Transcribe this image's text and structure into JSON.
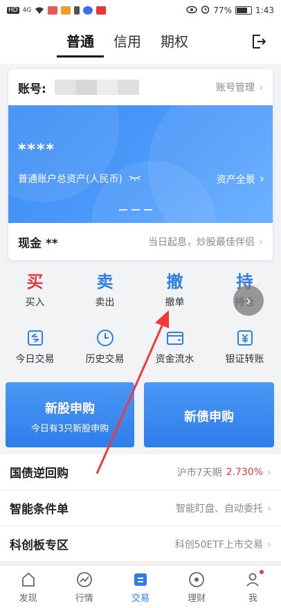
{
  "status_bar": {
    "network": "HD",
    "signal": "4G",
    "battery_percent": "77%",
    "time": "1:43"
  },
  "header": {
    "tabs": [
      {
        "label": "普通",
        "active": true
      },
      {
        "label": "信用",
        "active": false
      },
      {
        "label": "期权",
        "active": false
      }
    ],
    "exit_icon": "exit-icon"
  },
  "account": {
    "label": "账号:",
    "manage_label": "账号管理",
    "total_asset_value": "****",
    "total_asset_label": "普通账户总资产(人民币)",
    "asset_overview": "资产全景",
    "cash_label": "现金 **",
    "cash_tip": "当日起息，炒股最佳伴侣"
  },
  "trade_actions": [
    {
      "char": "买",
      "label": "买入"
    },
    {
      "char": "卖",
      "label": "卖出"
    },
    {
      "char": "撤",
      "label": "撤单"
    },
    {
      "char": "持",
      "label": "持仓"
    }
  ],
  "tools": [
    {
      "label": "今日交易",
      "icon": "today-trade-icon"
    },
    {
      "label": "历史交易",
      "icon": "clock-icon"
    },
    {
      "label": "资金流水",
      "icon": "wallet-icon"
    },
    {
      "label": "银证转账",
      "icon": "bank-transfer-icon"
    }
  ],
  "ipo": {
    "stock_title": "新股申购",
    "stock_sub": "今日有3只新股申购",
    "bond_title": "新债申购"
  },
  "list": [
    {
      "title": "国债逆回购",
      "right_text": "沪市7天期",
      "right_value": "2.730%"
    },
    {
      "title": "智能条件单",
      "right_text": "智能盯盘、自动委托",
      "right_value": ""
    },
    {
      "title": "科创板专区",
      "right_text": "科创50ETF上市交易",
      "right_value": ""
    }
  ],
  "bottom_nav": [
    {
      "label": "发现",
      "icon": "discover-icon",
      "active": false
    },
    {
      "label": "行情",
      "icon": "market-icon",
      "active": false
    },
    {
      "label": "交易",
      "icon": "trade-icon",
      "active": true
    },
    {
      "label": "理财",
      "icon": "finance-icon",
      "active": false
    },
    {
      "label": "我",
      "icon": "profile-icon",
      "active": false
    }
  ],
  "colors": {
    "accent_blue": "#2f7de9",
    "buy_red": "#e23b3b",
    "arrow_red": "#f03a3a"
  }
}
